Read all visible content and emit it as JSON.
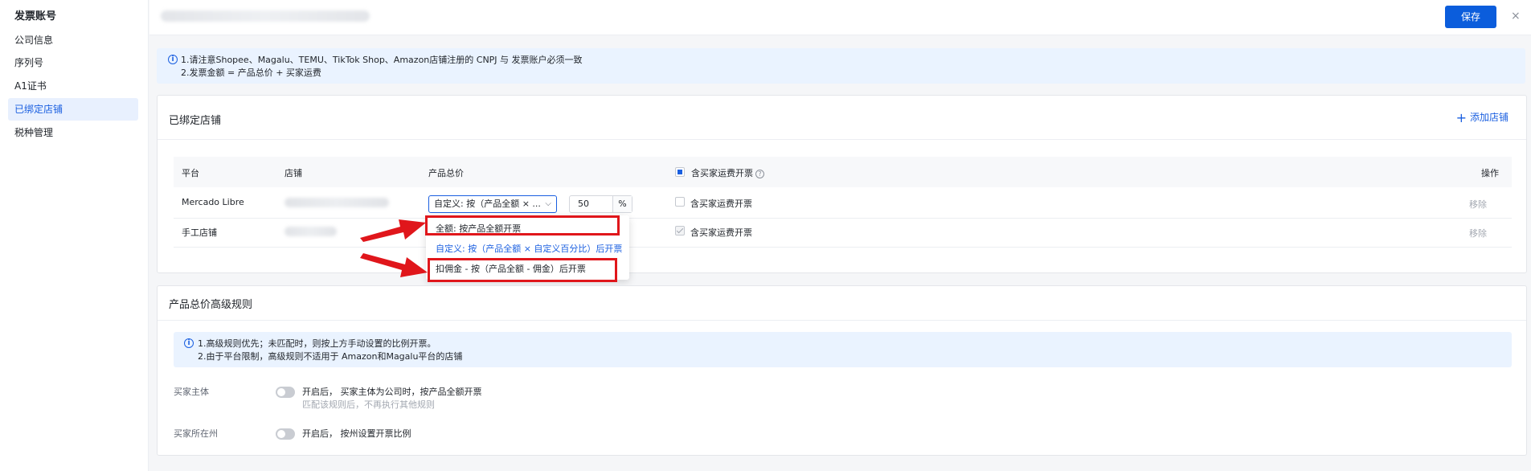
{
  "sidebar": {
    "title": "发票账号",
    "items": [
      {
        "label": "公司信息"
      },
      {
        "label": "序列号"
      },
      {
        "label": "A1证书"
      },
      {
        "label": "已绑定店铺"
      },
      {
        "label": "税种管理"
      }
    ]
  },
  "header": {
    "save_label": "保存",
    "close_label": "×"
  },
  "notice": {
    "line1": "1.请注意Shopee、Magalu、TEMU、TikTok Shop、Amazon店铺注册的 CNPJ 与 发票账户必须一致",
    "line2": "2.发票金额 = 产品总价 + 买家运费"
  },
  "bound_shops": {
    "title": "已绑定店铺",
    "add_label": "添加店铺",
    "columns": {
      "platform": "平台",
      "shop": "店铺",
      "total": "产品总价",
      "shipping": "含买家运费开票",
      "help": "?",
      "action": "操作"
    },
    "rows": [
      {
        "platform": "Mercado Libre",
        "select_value": "自定义: 按（产品全额 × ...",
        "chevron": "⌵",
        "percent": "50",
        "unit": "%",
        "shipping_label": "含买家运费开票",
        "action": "移除"
      },
      {
        "platform": "手工店铺",
        "shipping_label": "含买家运费开票",
        "action": "移除"
      }
    ]
  },
  "dropdown": {
    "options": [
      {
        "label": "全额: 按产品全额开票"
      },
      {
        "label": "自定义: 按（产品全额 × 自定义百分比）后开票"
      },
      {
        "label": "扣佣金 - 按（产品全额 - 佣金）后开票"
      }
    ]
  },
  "advanced": {
    "title": "产品总价高级规则",
    "notice_line1": "1.高级规则优先；未匹配时，则按上方手动设置的比例开票。",
    "notice_line2": "2.由于平台限制，高级规则不适用于 Amazon和Magalu平台的店铺",
    "rules": [
      {
        "label": "买家主体",
        "desc": "开启后，  买家主体为公司时，按产品全额开票",
        "subdesc": "匹配该规则后，不再执行其他规则"
      },
      {
        "label": "买家所在州",
        "desc": "开启后，  按州设置开票比例"
      }
    ]
  },
  "icons": {
    "info": "i",
    "plus": "+"
  },
  "colors": {
    "primary": "#0b5ddc",
    "highlight": "#e0161b",
    "notice_bg": "#eaf3ff"
  }
}
